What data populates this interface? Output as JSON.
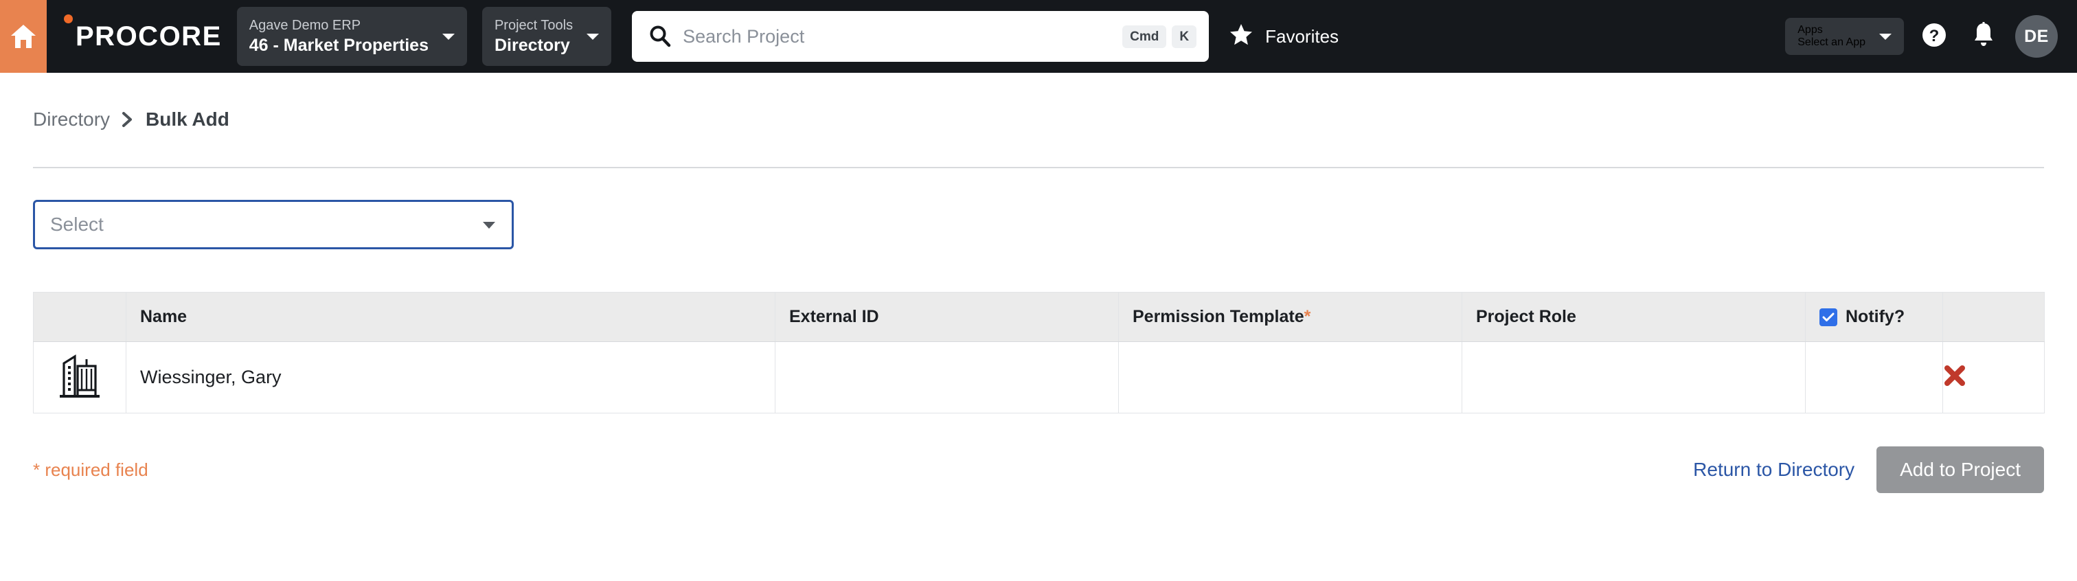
{
  "brand": {
    "name": "PROCORE",
    "home_icon": "home-icon",
    "accent_orange": "#e8834f",
    "nav_background": "#15181c"
  },
  "topnav": {
    "company_select": {
      "label": "Agave Demo ERP",
      "value": "46 - Market Properties",
      "caret_icon": "chevron-down-icon"
    },
    "tool_select": {
      "label": "Project Tools",
      "value": "Directory",
      "caret_icon": "chevron-down-icon"
    },
    "search": {
      "placeholder": "Search Project",
      "value": "",
      "icon": "search-icon",
      "shortcut_modifier": "Cmd",
      "shortcut_key": "K"
    },
    "favorites": {
      "label": "Favorites",
      "icon": "star-icon"
    },
    "apps_select": {
      "label": "Apps",
      "value": "Select an App",
      "caret_icon": "chevron-down-icon"
    },
    "help_icon": "question-circle-icon",
    "notifications_icon": "bell-icon",
    "avatar_initials": "DE"
  },
  "breadcrumb": {
    "parent": "Directory",
    "separator_icon": "chevron-right-icon",
    "current": "Bulk Add"
  },
  "filter": {
    "select_placeholder": "Select",
    "select_value": "",
    "caret_icon": "chevron-down-icon",
    "focus_color": "#2b56a6"
  },
  "table": {
    "columns": [
      {
        "key": "icon",
        "label": ""
      },
      {
        "key": "name",
        "label": "Name"
      },
      {
        "key": "external_id",
        "label": "External ID"
      },
      {
        "key": "permission_template",
        "label": "Permission Template",
        "required": true
      },
      {
        "key": "project_role",
        "label": "Project Role"
      },
      {
        "key": "notify",
        "label": "Notify?",
        "checkbox_checked": true
      },
      {
        "key": "delete",
        "label": ""
      }
    ],
    "required_marker": "*",
    "notify_label": "Notify?",
    "rows": [
      {
        "icon": "building-icon",
        "name": "Wiessinger, Gary",
        "external_id": "",
        "permission_template": "",
        "project_role": "",
        "notify": true,
        "delete_icon": "red-x-icon"
      }
    ]
  },
  "footer": {
    "required_note": "* required field",
    "return_link": "Return to Directory",
    "submit_label": "Add to Project",
    "submit_disabled": true,
    "link_color": "#2b56a6",
    "note_color": "#e8834f"
  }
}
